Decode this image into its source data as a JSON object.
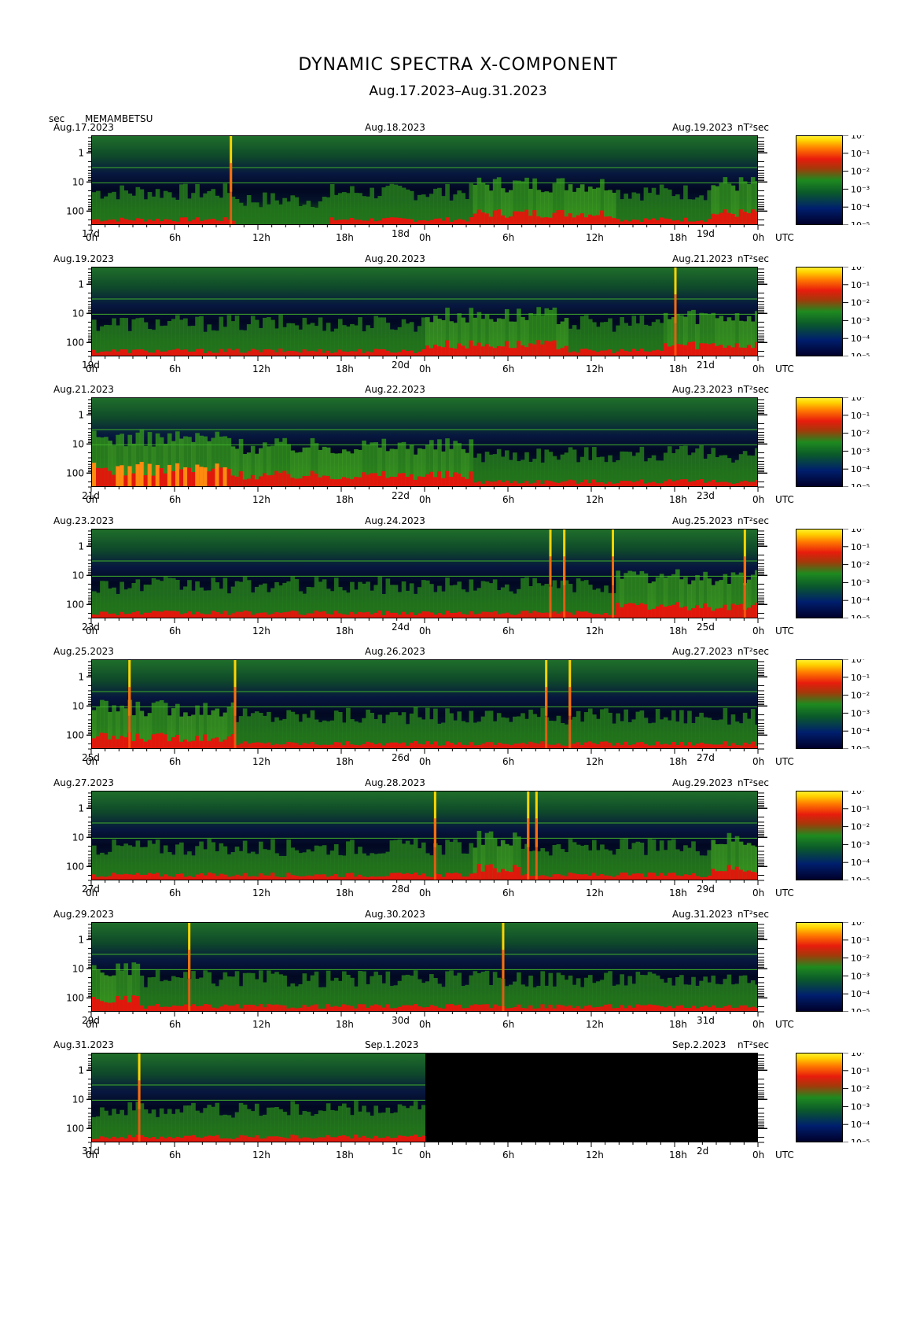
{
  "header": {
    "title": "DYNAMIC SPECTRA X-COMPONENT",
    "subtitle": "Aug.17.2023–Aug.31.2023",
    "unit_label": "sec",
    "station": "MEMAMBETSU"
  },
  "colors": {
    "background": "#ffffff",
    "spectrum_low": "#00002a",
    "spectrum_mid": "#1f8a1f",
    "spectrum_high": "#e81c0c",
    "spectrum_peak": "#ffd400"
  },
  "chart_data": {
    "type": "heatmap",
    "y_axis": {
      "label": "sec",
      "ticks": [
        "1",
        "10",
        "100"
      ],
      "scale": "log",
      "range": [
        0.25,
        300
      ]
    },
    "x_ticks": [
      "0h",
      "6h",
      "12h",
      "18h",
      "0h",
      "6h",
      "12h",
      "18h",
      "0h"
    ],
    "utc_label": "UTC",
    "colorbar": {
      "unit": "nT²sec",
      "ticks": [
        "10⁰",
        "10⁻¹",
        "10⁻²",
        "10⁻³",
        "10⁻⁴",
        "10⁻⁵"
      ],
      "range": [
        1e-05,
        1
      ]
    },
    "panels": [
      {
        "start_date": "Aug.17.2023",
        "mid_date": "Aug.18.2023",
        "end_date": "Aug.19.2023",
        "start_day": "17d",
        "mid_day": "18d",
        "end_day": "19d",
        "data_until_hour": 48,
        "spikes_hours": [
          10
        ],
        "activity": [
          1,
          1,
          1,
          0,
          0,
          1,
          1,
          1,
          2,
          2,
          2,
          1,
          1,
          2
        ]
      },
      {
        "start_date": "Aug.19.2023",
        "mid_date": "Aug.20.2023",
        "end_date": "Aug.21.2023",
        "start_day": "19d",
        "mid_day": "20d",
        "end_day": "21d",
        "data_until_hour": 48,
        "spikes_hours": [
          42
        ],
        "activity": [
          1,
          1,
          1,
          1,
          1,
          1,
          1,
          2,
          2,
          2,
          1,
          1,
          2,
          2
        ]
      },
      {
        "start_date": "Aug.21.2023",
        "mid_date": "Aug.22.2023",
        "end_date": "Aug.23.2023",
        "start_day": "21d",
        "mid_day": "22d",
        "end_day": "23d",
        "data_until_hour": 48,
        "spikes_hours": [],
        "activity": [
          3,
          3,
          3,
          2,
          2,
          2,
          2,
          2,
          1,
          1,
          1,
          1,
          1,
          1
        ]
      },
      {
        "start_date": "Aug.23.2023",
        "mid_date": "Aug.24.2023",
        "end_date": "Aug.25.2023",
        "start_day": "23d",
        "mid_day": "24d",
        "end_day": "25d",
        "data_until_hour": 48,
        "spikes_hours": [
          33,
          34,
          37.5,
          47
        ],
        "activity": [
          1,
          1,
          1,
          1,
          1,
          1,
          1,
          1,
          1,
          1,
          1,
          2,
          2,
          2
        ]
      },
      {
        "start_date": "Aug.25.2023",
        "mid_date": "Aug.26.2023",
        "end_date": "Aug.27.2023",
        "start_day": "25d",
        "mid_day": "26d",
        "end_day": "27d",
        "data_until_hour": 48,
        "spikes_hours": [
          2.7,
          10.3,
          32.7,
          34.4
        ],
        "activity": [
          2,
          2,
          2,
          1,
          1,
          1,
          1,
          1,
          1,
          1,
          1,
          1,
          1,
          1
        ]
      },
      {
        "start_date": "Aug.27.2023",
        "mid_date": "Aug.28.2023",
        "end_date": "Aug.29.2023",
        "start_day": "27d",
        "mid_day": "28d",
        "end_day": "29d",
        "data_until_hour": 48,
        "spikes_hours": [
          24.7,
          31.4,
          32
        ],
        "activity": [
          1,
          1,
          1,
          1,
          1,
          1,
          1,
          1,
          2,
          1,
          1,
          1,
          1,
          2
        ]
      },
      {
        "start_date": "Aug.29.2023",
        "mid_date": "Aug.30.2023",
        "end_date": "Aug.31.2023",
        "start_day": "29d",
        "mid_day": "30d",
        "end_day": "31d",
        "data_until_hour": 48,
        "spikes_hours": [
          7,
          29.6
        ],
        "activity": [
          2,
          1,
          1,
          1,
          1,
          1,
          1,
          1,
          1,
          1,
          1,
          1,
          1,
          1
        ]
      },
      {
        "start_date": "Aug.31.2023",
        "mid_date": "Sep.1.2023",
        "end_date": "Sep.2.2023",
        "start_day": "31d",
        "mid_day": "1c",
        "end_day": "2d",
        "data_until_hour": 24,
        "spikes_hours": [
          3.4
        ],
        "activity": [
          1,
          1,
          1,
          1,
          1,
          1,
          1,
          0,
          0,
          0,
          0,
          0,
          0,
          0
        ]
      }
    ]
  }
}
